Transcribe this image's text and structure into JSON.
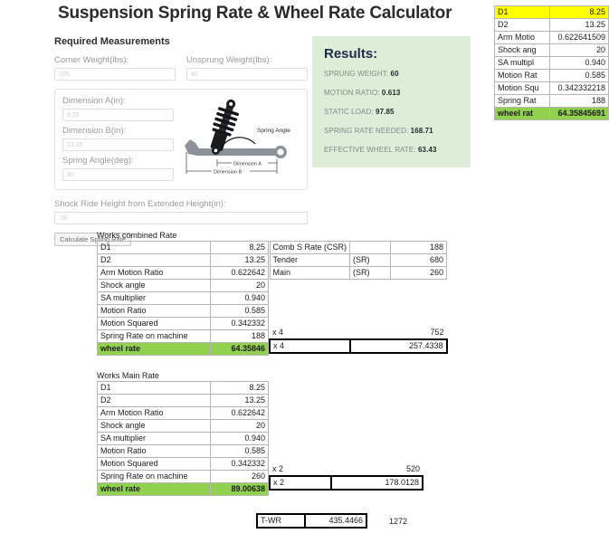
{
  "page_title": "Suspension Spring Rate & Wheel Rate Calculator",
  "colors": {
    "results_bg": "#ddeed8",
    "results_heading": "#1c2b4a",
    "highlight_yellow": "#ffff00",
    "highlight_green": "#92d050"
  },
  "form": {
    "section_heading": "Required Measurements",
    "fields": [
      {
        "label": "Corner Weight(lbs):",
        "value": "105"
      },
      {
        "label": "Unsprung Weight(lbs):",
        "value": "45"
      },
      {
        "label": "Dimension A(in):",
        "value": "8.25"
      },
      {
        "label": "Dimension B(in):",
        "value": "13.25"
      },
      {
        "label": "Spring Angle(deg):",
        "value": "80"
      },
      {
        "label": "Shock Ride Height from Extended Height(in):",
        "value": ".58"
      }
    ],
    "submit_label": "Calculate Spring Rate",
    "diagram": {
      "spring_angle_label": "Spring Angle",
      "dimension_a_label": "Dimension A",
      "dimension_b_label": "Dimension B"
    }
  },
  "results": {
    "title": "Results:",
    "lines": [
      {
        "label": "SPRUNG WEIGHT:",
        "value": "60"
      },
      {
        "label": "MOTION RATIO:",
        "value": "0.613"
      },
      {
        "label": "STATIC LOAD:",
        "value": "97.85"
      },
      {
        "label": "SPRING RATE NEEDED:",
        "value": "168.71"
      },
      {
        "label": "EFFECTIVE WHEEL RATE:",
        "value": "63.43"
      }
    ]
  },
  "top_right_table": {
    "rows": [
      {
        "label": "D1",
        "value": "8.25",
        "highlight": "yellow"
      },
      {
        "label": "D2",
        "value": "13.25",
        "highlight": ""
      },
      {
        "label": "Arm Motio",
        "value": "0.622641509",
        "highlight": ""
      },
      {
        "label": "Shock ang",
        "value": "20",
        "highlight": ""
      },
      {
        "label": "SA multipl",
        "value": "0.940",
        "highlight": ""
      },
      {
        "label": "Motion Rat",
        "value": "0.585",
        "highlight": ""
      },
      {
        "label": "Motion Squ",
        "value": "0.342332218",
        "highlight": ""
      },
      {
        "label": "Spring Rat",
        "value": "188",
        "highlight": ""
      },
      {
        "label": "wheel rat",
        "value": "64.35845691",
        "highlight": "green"
      }
    ]
  },
  "works_combined": {
    "title": "Works combined Rate",
    "rows": [
      {
        "label": "D1",
        "value": "8.25"
      },
      {
        "label": "D2",
        "value": "13.25"
      },
      {
        "label": "Arm Motion Ratio",
        "value": "0.622642"
      },
      {
        "label": "Shock angle",
        "value": "20"
      },
      {
        "label": "SA multiplier",
        "value": "0.940"
      },
      {
        "label": "Motion Ratio",
        "value": "0.585"
      },
      {
        "label": "Motion Squared",
        "value": "0.342332"
      },
      {
        "label": "Spring Rate on machine",
        "value": "188"
      },
      {
        "label": "wheel rate",
        "value": "64.35846",
        "highlight": "green"
      }
    ],
    "side_rows": [
      {
        "c1": "Comb S Rate (CSR)",
        "c2": "",
        "c3": "188"
      },
      {
        "c1": "Tender",
        "c2": "(SR)",
        "c3": "680"
      },
      {
        "c1": "Main",
        "c2": "(SR)",
        "c3": "260"
      }
    ],
    "mult_plain": {
      "label": "x 4",
      "value": "752"
    },
    "mult_boxed": {
      "label": "x 4",
      "value": "257.4338"
    }
  },
  "works_main": {
    "title": "Works Main Rate",
    "rows": [
      {
        "label": "D1",
        "value": "8.25"
      },
      {
        "label": "D2",
        "value": "13.25"
      },
      {
        "label": "Arm Motion Ratio",
        "value": "0.622642"
      },
      {
        "label": "Shock angle",
        "value": "20"
      },
      {
        "label": "SA multiplier",
        "value": "0.940"
      },
      {
        "label": "Motion Ratio",
        "value": "0.585"
      },
      {
        "label": "Motion Squared",
        "value": "0.342332"
      },
      {
        "label": "Spring Rate on machine",
        "value": "260"
      },
      {
        "label": "wheel rate",
        "value": "89.00638",
        "highlight": "green"
      }
    ],
    "mult_plain": {
      "label": "x 2",
      "value": "520"
    },
    "mult_boxed": {
      "label": "x 2",
      "value": "178.0128"
    }
  },
  "footer": {
    "twr_label": "T-WR",
    "twr_value": "435.4466",
    "extra_value": "1272"
  }
}
